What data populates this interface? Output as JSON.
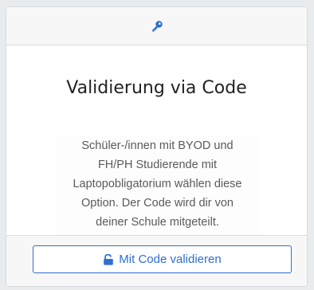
{
  "header": {
    "icon": "key-icon",
    "accent_color": "#2f6fd0"
  },
  "body": {
    "title": "Validierung via Code",
    "text_lines": [
      "Schüler-/innen mit BYOD und",
      "FH/PH Studierende mit",
      "Laptopobligatorium wählen diese",
      "Option. Der Code wird dir von",
      "deiner Schule mitgeteilt."
    ]
  },
  "footer": {
    "button_label": "Mit Code validieren",
    "button_icon": "unlock-icon"
  }
}
